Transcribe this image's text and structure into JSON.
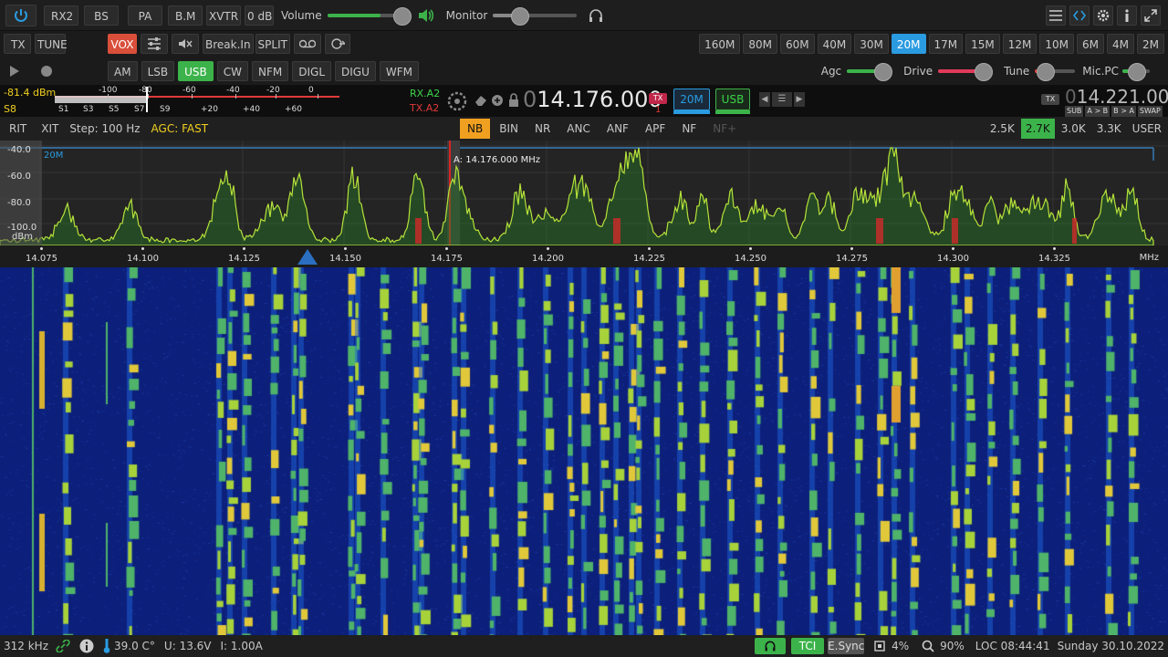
{
  "top": {
    "rx2": "RX2",
    "bs": "BS",
    "pa": "PA",
    "bm": "B.M",
    "xvtr": "XVTR",
    "att": "0 dB",
    "volume_label": "Volume",
    "volume_level": 0.7,
    "monitor_label": "Monitor",
    "monitor_level": 0.3
  },
  "row2": {
    "tx": "TX",
    "tune": "TUNE",
    "vox": "VOX",
    "breakin": "Break.In",
    "split": "SPLIT",
    "bands": [
      "160M",
      "80M",
      "60M",
      "40M",
      "30M",
      "20M",
      "17M",
      "15M",
      "12M",
      "10M",
      "6M",
      "4M",
      "2M"
    ],
    "active_band": "20M"
  },
  "row3": {
    "modes": [
      "AM",
      "LSB",
      "USB",
      "CW",
      "NFM",
      "DIGL",
      "DIGU",
      "WFM"
    ],
    "active_mode": "USB",
    "agc_label": "Agc",
    "drive_label": "Drive",
    "tune_label": "Tune",
    "micpc_label": "Mic.PC"
  },
  "meter": {
    "dbm": "-81.4 dBm",
    "s_reading": "S8",
    "top_scale": [
      "-100",
      "-80",
      "-60",
      "-40",
      "-20",
      "0"
    ],
    "bottom_scale": [
      "S1",
      "S3",
      "S5",
      "S7",
      "S9",
      "+20",
      "+40",
      "+60"
    ]
  },
  "vfo": {
    "rx": "RX.A2",
    "tx": "TX.A2",
    "freq_dim": "0",
    "freq_main": "14.176.000",
    "tx_badge": "TX",
    "tx_num": "1",
    "band_btn": "20M",
    "mode_btn": "USB",
    "sub_tx": "TX",
    "sub_freq_dim": "0",
    "sub_freq": "14.221.000",
    "sub_buttons": [
      "SUB",
      "A > B",
      "B > A",
      "SWAP"
    ]
  },
  "row5": {
    "rit": "RIT",
    "xit": "XIT",
    "step": "Step: 100 Hz",
    "agc": "AGC: FAST",
    "dsp": [
      "NB",
      "BIN",
      "NR",
      "ANC",
      "ANF",
      "APF",
      "NF",
      "NF+"
    ],
    "active_dsp": "NB",
    "filters": [
      "2.5K",
      "2.7K",
      "3.0K",
      "3.3K",
      "USER"
    ],
    "active_filter": "2.7K"
  },
  "spectrum": {
    "db_labels": [
      "-40.0",
      "-60.0",
      "-80.0",
      "-100.0"
    ],
    "unit": "dBm",
    "band_label": "20M",
    "marker": "A: 14.176.000 MHz",
    "freq_labels": [
      "14.075",
      "14.100",
      "14.125",
      "14.150",
      "14.175",
      "14.200",
      "14.225",
      "14.250",
      "14.275",
      "14.300",
      "14.325"
    ],
    "freq_unit": "MHz"
  },
  "status": {
    "bandwidth": "312 kHz",
    "temp": "39.0 C°",
    "voltage": "U: 13.6V",
    "current": "I: 1.00A",
    "tci": "TCI",
    "esync": "E.Sync",
    "cpu": "4%",
    "zoom": "90%",
    "loc": "LOC 08:44:41",
    "date": "Sunday 30.10.2022"
  },
  "colors": {
    "accent_green": "#3cb34a",
    "accent_blue": "#2a9be0",
    "vox_red": "#d94f3a",
    "rx_green": "#3cd34a",
    "tx_red": "#e23a3a"
  }
}
